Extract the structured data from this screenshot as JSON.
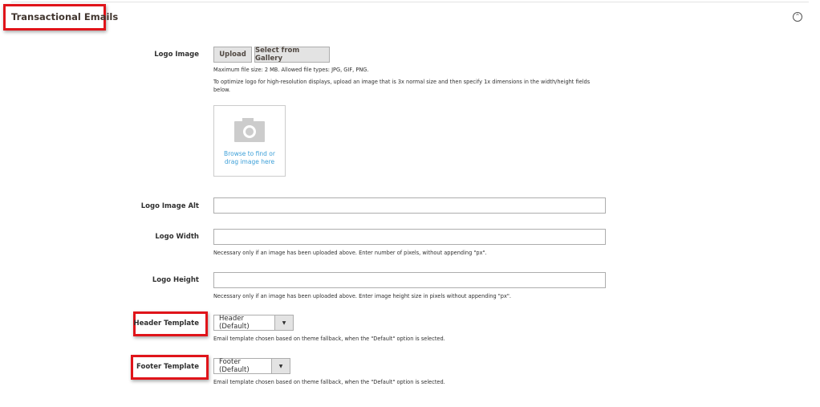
{
  "section": {
    "title": "Transactional Emails",
    "collapse_icon": "collapse-circle-icon"
  },
  "logo_image": {
    "label": "Logo Image",
    "upload": "Upload",
    "gallery": "Select from Gallery",
    "note1": "Maximum file size: 2 MB. Allowed file types: JPG, GIF, PNG.",
    "note2": "To optimize logo for high-resolution displays, upload an image that is 3x normal size and then specify 1x dimensions in the width/height fields below.",
    "browse": "Browse to find or drag image here",
    "icon": "camera-icon"
  },
  "logo_alt": {
    "label": "Logo Image Alt",
    "value": ""
  },
  "logo_width": {
    "label": "Logo Width",
    "value": "",
    "note": "Necessary only if an image has been uploaded above. Enter number of pixels, without appending \"px\"."
  },
  "logo_height": {
    "label": "Logo Height",
    "value": "",
    "note": "Necessary only if an image has been uploaded above. Enter image height size in pixels without appending \"px\"."
  },
  "header_template": {
    "label": "Header Template",
    "value": "Header (Default)",
    "note": "Email template chosen based on theme fallback, when the \"Default\" option is selected."
  },
  "footer_template": {
    "label": "Footer Template",
    "value": "Footer (Default)",
    "note": "Email template chosen based on theme fallback, when the \"Default\" option is selected."
  },
  "colors": {
    "highlight": "#e0141a",
    "link": "#3ea0d8"
  }
}
